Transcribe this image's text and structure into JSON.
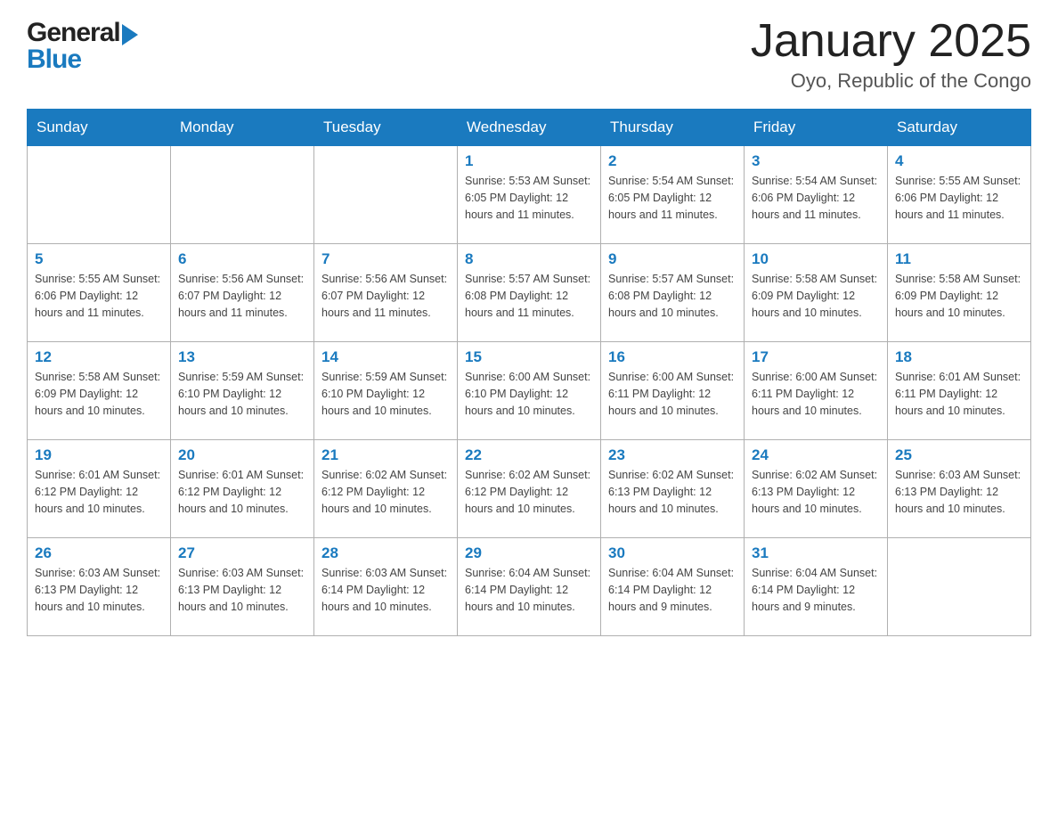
{
  "logo": {
    "general": "General",
    "arrow": "",
    "blue": "Blue"
  },
  "title": "January 2025",
  "subtitle": "Oyo, Republic of the Congo",
  "days": [
    "Sunday",
    "Monday",
    "Tuesday",
    "Wednesday",
    "Thursday",
    "Friday",
    "Saturday"
  ],
  "weeks": [
    [
      {
        "day": "",
        "info": ""
      },
      {
        "day": "",
        "info": ""
      },
      {
        "day": "",
        "info": ""
      },
      {
        "day": "1",
        "info": "Sunrise: 5:53 AM\nSunset: 6:05 PM\nDaylight: 12 hours\nand 11 minutes."
      },
      {
        "day": "2",
        "info": "Sunrise: 5:54 AM\nSunset: 6:05 PM\nDaylight: 12 hours\nand 11 minutes."
      },
      {
        "day": "3",
        "info": "Sunrise: 5:54 AM\nSunset: 6:06 PM\nDaylight: 12 hours\nand 11 minutes."
      },
      {
        "day": "4",
        "info": "Sunrise: 5:55 AM\nSunset: 6:06 PM\nDaylight: 12 hours\nand 11 minutes."
      }
    ],
    [
      {
        "day": "5",
        "info": "Sunrise: 5:55 AM\nSunset: 6:06 PM\nDaylight: 12 hours\nand 11 minutes."
      },
      {
        "day": "6",
        "info": "Sunrise: 5:56 AM\nSunset: 6:07 PM\nDaylight: 12 hours\nand 11 minutes."
      },
      {
        "day": "7",
        "info": "Sunrise: 5:56 AM\nSunset: 6:07 PM\nDaylight: 12 hours\nand 11 minutes."
      },
      {
        "day": "8",
        "info": "Sunrise: 5:57 AM\nSunset: 6:08 PM\nDaylight: 12 hours\nand 11 minutes."
      },
      {
        "day": "9",
        "info": "Sunrise: 5:57 AM\nSunset: 6:08 PM\nDaylight: 12 hours\nand 10 minutes."
      },
      {
        "day": "10",
        "info": "Sunrise: 5:58 AM\nSunset: 6:09 PM\nDaylight: 12 hours\nand 10 minutes."
      },
      {
        "day": "11",
        "info": "Sunrise: 5:58 AM\nSunset: 6:09 PM\nDaylight: 12 hours\nand 10 minutes."
      }
    ],
    [
      {
        "day": "12",
        "info": "Sunrise: 5:58 AM\nSunset: 6:09 PM\nDaylight: 12 hours\nand 10 minutes."
      },
      {
        "day": "13",
        "info": "Sunrise: 5:59 AM\nSunset: 6:10 PM\nDaylight: 12 hours\nand 10 minutes."
      },
      {
        "day": "14",
        "info": "Sunrise: 5:59 AM\nSunset: 6:10 PM\nDaylight: 12 hours\nand 10 minutes."
      },
      {
        "day": "15",
        "info": "Sunrise: 6:00 AM\nSunset: 6:10 PM\nDaylight: 12 hours\nand 10 minutes."
      },
      {
        "day": "16",
        "info": "Sunrise: 6:00 AM\nSunset: 6:11 PM\nDaylight: 12 hours\nand 10 minutes."
      },
      {
        "day": "17",
        "info": "Sunrise: 6:00 AM\nSunset: 6:11 PM\nDaylight: 12 hours\nand 10 minutes."
      },
      {
        "day": "18",
        "info": "Sunrise: 6:01 AM\nSunset: 6:11 PM\nDaylight: 12 hours\nand 10 minutes."
      }
    ],
    [
      {
        "day": "19",
        "info": "Sunrise: 6:01 AM\nSunset: 6:12 PM\nDaylight: 12 hours\nand 10 minutes."
      },
      {
        "day": "20",
        "info": "Sunrise: 6:01 AM\nSunset: 6:12 PM\nDaylight: 12 hours\nand 10 minutes."
      },
      {
        "day": "21",
        "info": "Sunrise: 6:02 AM\nSunset: 6:12 PM\nDaylight: 12 hours\nand 10 minutes."
      },
      {
        "day": "22",
        "info": "Sunrise: 6:02 AM\nSunset: 6:12 PM\nDaylight: 12 hours\nand 10 minutes."
      },
      {
        "day": "23",
        "info": "Sunrise: 6:02 AM\nSunset: 6:13 PM\nDaylight: 12 hours\nand 10 minutes."
      },
      {
        "day": "24",
        "info": "Sunrise: 6:02 AM\nSunset: 6:13 PM\nDaylight: 12 hours\nand 10 minutes."
      },
      {
        "day": "25",
        "info": "Sunrise: 6:03 AM\nSunset: 6:13 PM\nDaylight: 12 hours\nand 10 minutes."
      }
    ],
    [
      {
        "day": "26",
        "info": "Sunrise: 6:03 AM\nSunset: 6:13 PM\nDaylight: 12 hours\nand 10 minutes."
      },
      {
        "day": "27",
        "info": "Sunrise: 6:03 AM\nSunset: 6:13 PM\nDaylight: 12 hours\nand 10 minutes."
      },
      {
        "day": "28",
        "info": "Sunrise: 6:03 AM\nSunset: 6:14 PM\nDaylight: 12 hours\nand 10 minutes."
      },
      {
        "day": "29",
        "info": "Sunrise: 6:04 AM\nSunset: 6:14 PM\nDaylight: 12 hours\nand 10 minutes."
      },
      {
        "day": "30",
        "info": "Sunrise: 6:04 AM\nSunset: 6:14 PM\nDaylight: 12 hours\nand 9 minutes."
      },
      {
        "day": "31",
        "info": "Sunrise: 6:04 AM\nSunset: 6:14 PM\nDaylight: 12 hours\nand 9 minutes."
      },
      {
        "day": "",
        "info": ""
      }
    ]
  ]
}
